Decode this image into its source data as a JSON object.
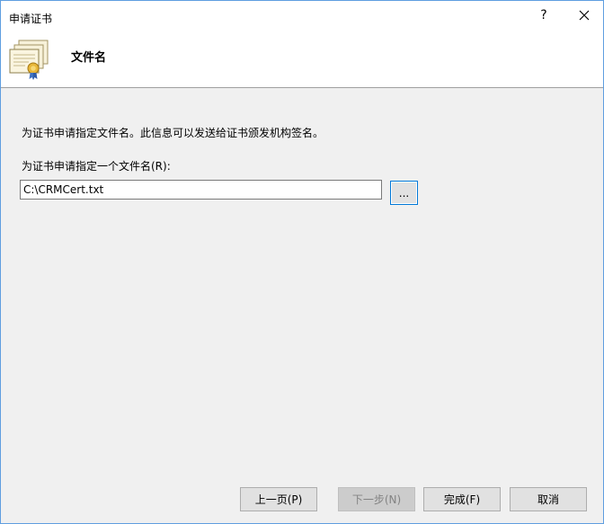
{
  "window": {
    "title": "申请证书",
    "help_label": "?",
    "close_icon": "close-icon"
  },
  "header": {
    "icon": "certificate-icon",
    "heading": "文件名"
  },
  "main": {
    "description": "为证书申请指定文件名。此信息可以发送给证书颁发机构签名。",
    "field_label": "为证书申请指定一个文件名(R):",
    "filename_value": "C:\\CRMCert.txt",
    "browse_label": "..."
  },
  "footer": {
    "back_label": "上一页(P)",
    "next_label": "下一步(N)",
    "finish_label": "完成(F)",
    "cancel_label": "取消"
  }
}
